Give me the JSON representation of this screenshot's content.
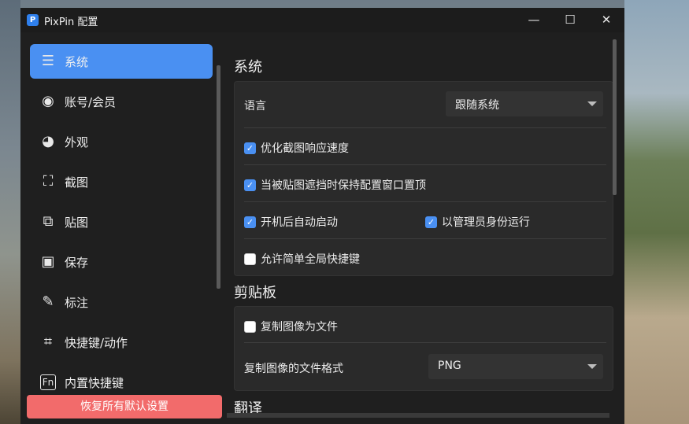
{
  "window": {
    "title": "PixPin 配置",
    "logo_text": "P"
  },
  "titlebar": {
    "minimize": "—",
    "maximize": "☐",
    "close": "✕"
  },
  "sidebar": {
    "items": [
      {
        "label": "系统",
        "icon": "sliders-icon",
        "glyph": "☰",
        "active": true
      },
      {
        "label": "账号/会员",
        "icon": "user-icon",
        "glyph": "◉"
      },
      {
        "label": "外观",
        "icon": "palette-icon",
        "glyph": "◕"
      },
      {
        "label": "截图",
        "icon": "screenshot-icon",
        "glyph": "⛶"
      },
      {
        "label": "贴图",
        "icon": "pin-image-icon",
        "glyph": "⧉"
      },
      {
        "label": "保存",
        "icon": "save-icon",
        "glyph": "▣"
      },
      {
        "label": "标注",
        "icon": "pencil-icon",
        "glyph": "✎"
      },
      {
        "label": "快捷键/动作",
        "icon": "hashtag-icon",
        "glyph": "⌗"
      },
      {
        "label": "内置快捷键",
        "icon": "fn-key-icon",
        "glyph": "Fn"
      }
    ],
    "reset_label": "恢复所有默认设置"
  },
  "system": {
    "title": "系统",
    "language_label": "语言",
    "language_value": "跟随系统",
    "optimize_speed_label": "优化截图响应速度",
    "optimize_speed_checked": true,
    "keep_config_top_label": "当被贴图遮挡时保持配置窗口置顶",
    "keep_config_top_checked": true,
    "autostart_label": "开机后自动启动",
    "autostart_checked": true,
    "run_as_admin_label": "以管理员身份运行",
    "run_as_admin_checked": true,
    "simple_global_hotkey_label": "允许简单全局快捷键",
    "simple_global_hotkey_checked": false
  },
  "clipboard": {
    "title": "剪贴板",
    "copy_as_file_label": "复制图像为文件",
    "copy_as_file_checked": false,
    "format_label": "复制图像的文件格式",
    "format_value": "PNG"
  },
  "translate": {
    "title": "翻译"
  },
  "colors": {
    "accent": "#4a90f2",
    "reset": "#f26b6b",
    "background": "#1f1f1f",
    "card": "#2a2a2a"
  }
}
